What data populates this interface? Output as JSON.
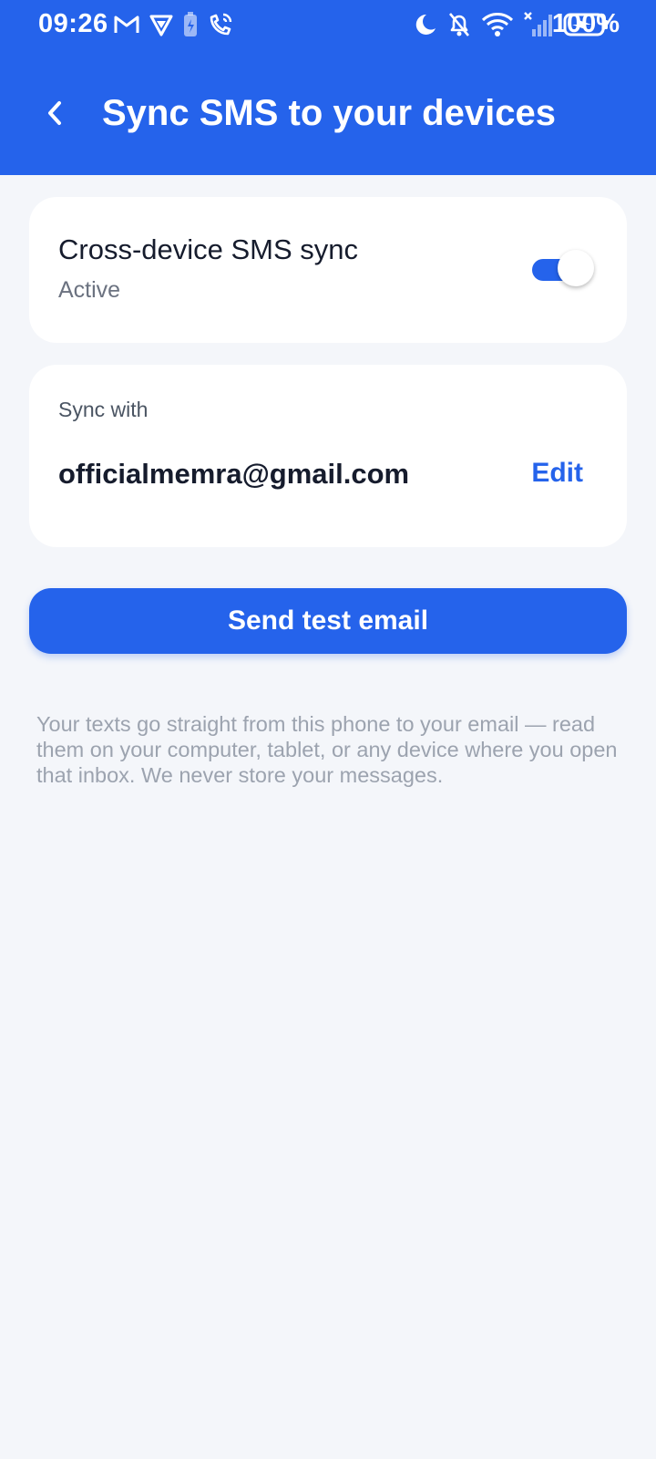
{
  "status_bar": {
    "time": "09:26",
    "battery_percent": "100%",
    "left_icons": [
      "gmail-icon",
      "vpn-shield-icon",
      "battery-saver-icon",
      "wifi-calling-icon"
    ],
    "right_icons": [
      "do-not-disturb-moon-icon",
      "muted-bell-icon",
      "wifi-icon",
      "no-signal-icon",
      "battery-charging-icon"
    ]
  },
  "header": {
    "title": "Sync SMS to your devices",
    "back_icon": "chevron-left-icon"
  },
  "sync_card": {
    "title": "Cross-device SMS sync",
    "status": "Active",
    "toggle_on": true
  },
  "email_card": {
    "label": "Sync with",
    "email": "officialmemra@gmail.com",
    "edit_label": "Edit"
  },
  "actions": {
    "send_test_label": "Send test email"
  },
  "info": {
    "text": "Your texts go straight from this phone to your email — read them on your computer, tablet, or any device where you open that inbox. We never store your messages."
  },
  "colors": {
    "primary": "#2563eb",
    "background": "#f4f6fa",
    "card": "#ffffff",
    "text_primary": "#161c2d",
    "text_secondary": "#6b7280",
    "text_muted": "#9ca3af"
  }
}
